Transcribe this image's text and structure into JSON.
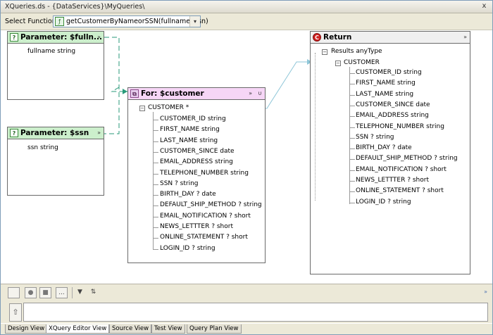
{
  "window": {
    "title": "XQueries.ds - {DataServices}\\MyQueries\\",
    "close_glyph": "x"
  },
  "toolbar": {
    "select_label": "Select Function:",
    "function_value": "getCustomerByNameorSSN(fullname, ssn)",
    "function_icon": "xquery-function-icon",
    "dropdown_glyph": "▾"
  },
  "canvas": {
    "param_fullname": {
      "title": "Parameter: $fulln...",
      "badge": "?",
      "collapse": "»",
      "item": "fullname  string"
    },
    "param_ssn": {
      "title": "Parameter: $ssn",
      "badge": "?",
      "collapse": "»",
      "item": "ssn  string"
    },
    "for_customer": {
      "title": "For: $customer",
      "collapse": "»",
      "pin": "∪",
      "root": "CUSTOMER *",
      "fields": [
        "CUSTOMER_ID  string",
        "FIRST_NAME  string",
        "LAST_NAME  string",
        "CUSTOMER_SINCE  date",
        "EMAIL_ADDRESS  string",
        "TELEPHONE_NUMBER  string",
        "SSN ?  string",
        "BIRTH_DAY ?  date",
        "DEFAULT_SHIP_METHOD ?  string",
        "EMAIL_NOTIFICATION ?  short",
        "NEWS_LETTTER ?  short",
        "ONLINE_STATEMENT ?  short",
        "LOGIN_ID ?  string"
      ]
    },
    "return": {
      "title": "Return",
      "collapse": "»",
      "results": "Results  anyType",
      "root": "CUSTOMER",
      "fields": [
        "CUSTOMER_ID  string",
        "FIRST_NAME  string",
        "LAST_NAME  string",
        "CUSTOMER_SINCE  date",
        "EMAIL_ADDRESS  string",
        "TELEPHONE_NUMBER  string",
        "SSN ?  string",
        "BIRTH_DAY ?  date",
        "DEFAULT_SHIP_METHOD ?  string",
        "EMAIL_NOTIFICATION ?  short",
        "NEWS_LETTTER ?  short",
        "ONLINE_STATEMENT ?  short",
        "LOGIN_ID ?  string"
      ]
    }
  },
  "bottom": {
    "more_label": "...",
    "up_glyph": "⇧",
    "collapse_glyph": "»"
  },
  "tabs": [
    "Design View",
    "XQuery Editor View",
    "Source View",
    "Test View",
    "Query Plan View"
  ],
  "colors": {
    "param_header": "#ccefcc",
    "for_header": "#f6d6f6",
    "wire_dashed": "#2a9a7a",
    "wire_solid": "#8ec6d8"
  }
}
